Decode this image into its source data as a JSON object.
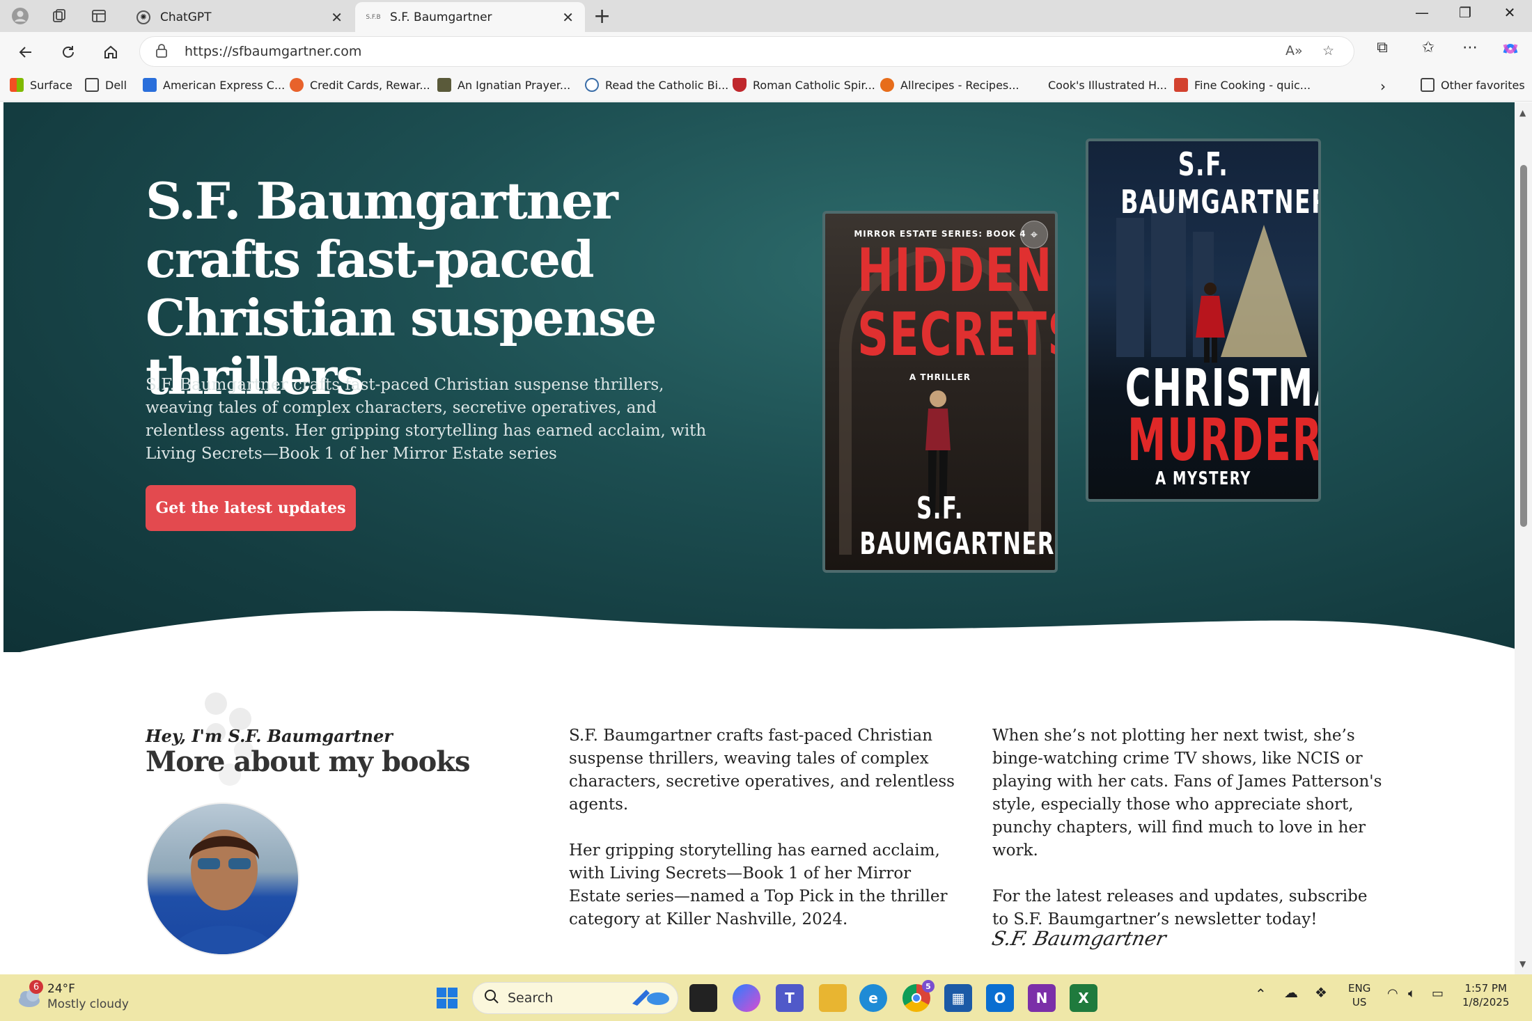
{
  "browser": {
    "tabs": [
      {
        "label": "ChatGPT",
        "active": false
      },
      {
        "label": "S.F. Baumgartner",
        "active": true
      }
    ],
    "url": "https://sfbaumgartner.com",
    "favorites": [
      {
        "label": "Surface",
        "color": "#f25022"
      },
      {
        "label": "Dell",
        "color": "#444444"
      },
      {
        "label": "American Express C...",
        "color": "#2a6fdb"
      },
      {
        "label": "Credit Cards, Rewar...",
        "color": "#e8622b"
      },
      {
        "label": "An Ignatian Prayer...",
        "color": "#5a5a3a"
      },
      {
        "label": "Read the Catholic Bi...",
        "color": "#3b6ea8"
      },
      {
        "label": "Roman Catholic Spir...",
        "color": "#c0282d"
      },
      {
        "label": "Allrecipes - Recipes...",
        "color": "#e76d1b"
      },
      {
        "label": "Cook's Illustrated H...",
        "color": ""
      },
      {
        "label": "Fine Cooking - quic...",
        "color": "#d3422f"
      }
    ],
    "other_favorites": "Other favorites"
  },
  "hero": {
    "title": "S.F. Baumgartner crafts fast-paced Christian suspense thrillers",
    "text": "S.F. Baumgartner crafts fast-paced Christian suspense thrillers, weaving tales of complex characters, secretive operatives, and relentless agents. Her gripping storytelling has earned acclaim, with Living Secrets—Book 1 of her Mirror Estate series",
    "cta": "Get the latest updates",
    "accent": "#e34a4f"
  },
  "books": [
    {
      "series": "MIRROR ESTATE SERIES: BOOK 4",
      "title_line1": "HIDDEN",
      "title_line2": "SECRETS",
      "subtitle": "A THRILLER",
      "author": "S.F. BAUMGARTNER"
    },
    {
      "author": "S.F. BAUMGARTNER",
      "title_line1": "CHRISTMAS",
      "title_line2": "MURDERS",
      "subtitle": "A MYSTERY"
    }
  ],
  "about": {
    "kicker": "Hey, I'm S.F. Baumgartner",
    "heading": "More about my books",
    "col1_p1": "S.F. Baumgartner crafts fast-paced Christian suspense thrillers, weaving tales of complex characters, secretive operatives, and relentless agents.",
    "col1_p2": "Her gripping storytelling has earned acclaim, with Living Secrets—Book 1 of her Mirror Estate series—named a Top Pick in the thriller category at Killer Nashville, 2024.",
    "col2_p1": "When she’s not plotting her next twist, she’s binge-watching crime TV shows, like NCIS or playing with her cats. Fans of James Patterson's style, especially those who appreciate short, punchy chapters, will find much to love in her work.",
    "col2_p2": "For the latest releases and updates, subscribe to S.F. Baumgartner’s newsletter today!",
    "signature": "S.F. Baumgartner"
  },
  "taskbar": {
    "weather_badge": "6",
    "temp": "24°F",
    "weather": "Mostly cloudy",
    "search": "Search",
    "lang1": "ENG",
    "lang2": "US",
    "time": "1:57 PM",
    "date": "1/8/2025",
    "chrome_badge": "5"
  }
}
